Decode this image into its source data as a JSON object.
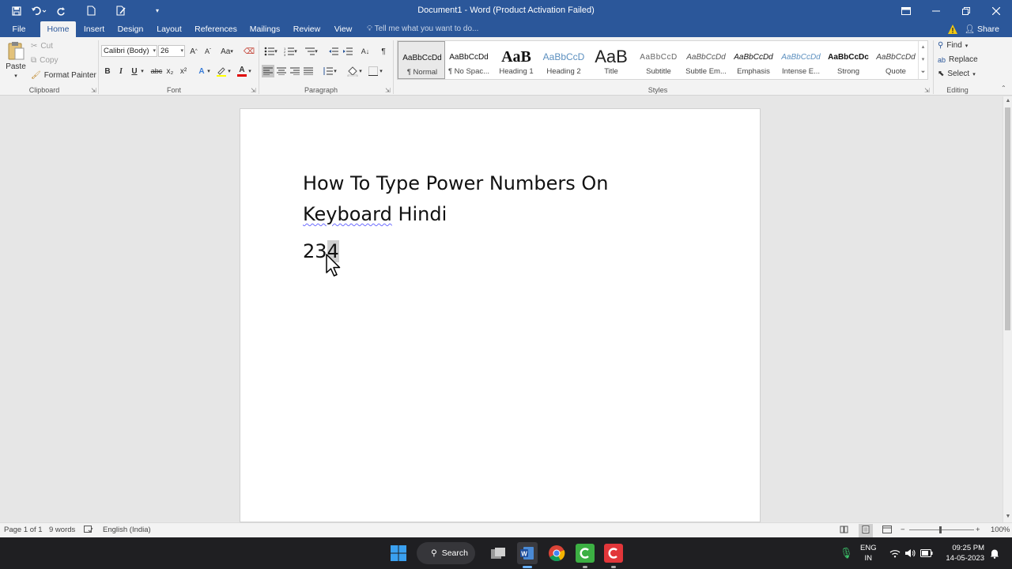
{
  "titlebar": {
    "title": "Document1 - Word (Product Activation Failed)"
  },
  "tabs": [
    "File",
    "Home",
    "Insert",
    "Design",
    "Layout",
    "References",
    "Mailings",
    "Review",
    "View"
  ],
  "tell_me": "Tell me what you want to do...",
  "share": "Share",
  "clipboard": {
    "paste": "Paste",
    "cut": "Cut",
    "copy": "Copy",
    "format_painter": "Format Painter",
    "label": "Clipboard"
  },
  "font": {
    "name": "Calibri (Body)",
    "size": "26",
    "label": "Font",
    "bold": "B",
    "italic": "I",
    "underline": "U",
    "strike": "abc",
    "subscript": "x₂",
    "superscript": "x²",
    "grow": "A",
    "change_case": "Aa"
  },
  "paragraph": {
    "label": "Paragraph"
  },
  "styles": {
    "label": "Styles",
    "items": [
      {
        "preview": "AaBbCcDd",
        "name": "¶ Normal"
      },
      {
        "preview": "AaBbCcDd",
        "name": "¶ No Spac..."
      },
      {
        "preview": "AaB",
        "name": "Heading 1"
      },
      {
        "preview": "AaBbCcD",
        "name": "Heading 2"
      },
      {
        "preview": "AaB",
        "name": "Title"
      },
      {
        "preview": "AaBbCcD",
        "name": "Subtitle"
      },
      {
        "preview": "AaBbCcDd",
        "name": "Subtle Em..."
      },
      {
        "preview": "AaBbCcDd",
        "name": "Emphasis"
      },
      {
        "preview": "AaBbCcDd",
        "name": "Intense E..."
      },
      {
        "preview": "AaBbCcDc",
        "name": "Strong"
      },
      {
        "preview": "AaBbCcDd",
        "name": "Quote"
      }
    ]
  },
  "editing": {
    "find": "Find",
    "replace": "Replace",
    "select": "Select",
    "label": "Editing"
  },
  "document": {
    "line1": "How To Type Power Numbers On",
    "line2_word": "Keyboard",
    "line2_rest": " Hindi",
    "line3_main": "23",
    "line3_selected": "4"
  },
  "status": {
    "page": "Page 1 of 1",
    "words": "9 words",
    "language": "English (India)",
    "zoom": "100%"
  },
  "taskbar": {
    "search": "Search",
    "lang1": "ENG",
    "lang2": "IN",
    "time": "09:25 PM",
    "date": "14-05-2023"
  }
}
